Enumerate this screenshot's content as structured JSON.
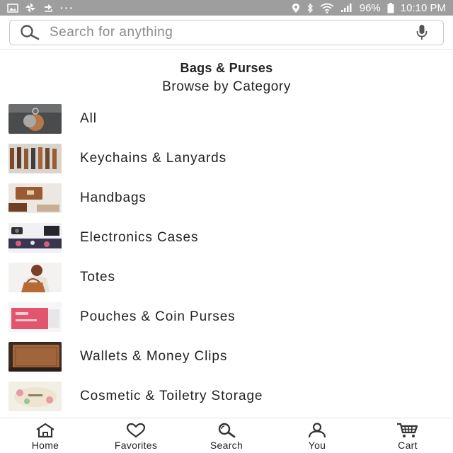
{
  "status_bar": {
    "left_icons": [
      "gallery-icon",
      "pinwheel-icon",
      "sync-icon"
    ],
    "more": "···",
    "battery": "96%",
    "time": "10:10 PM"
  },
  "search": {
    "placeholder": "Search for anything",
    "icon": "search-icon",
    "mic_icon": "mic-icon"
  },
  "header": {
    "title": "Bags & Purses",
    "subtitle": "Browse by Category"
  },
  "categories": [
    {
      "label": "All"
    },
    {
      "label": "Keychains & Lanyards"
    },
    {
      "label": "Handbags"
    },
    {
      "label": "Electronics Cases"
    },
    {
      "label": "Totes"
    },
    {
      "label": "Pouches & Coin Purses"
    },
    {
      "label": "Wallets & Money Clips"
    },
    {
      "label": "Cosmetic & Toiletry Storage"
    }
  ],
  "bottom_nav": [
    {
      "label": "Home",
      "icon": "home-icon"
    },
    {
      "label": "Favorites",
      "icon": "heart-icon"
    },
    {
      "label": "Search",
      "icon": "search-icon"
    },
    {
      "label": "You",
      "icon": "user-icon"
    },
    {
      "label": "Cart",
      "icon": "cart-icon"
    }
  ],
  "colors": {
    "status_bar": "#9e9e9e",
    "text": "#222222",
    "divider": "#e2e2e2"
  }
}
